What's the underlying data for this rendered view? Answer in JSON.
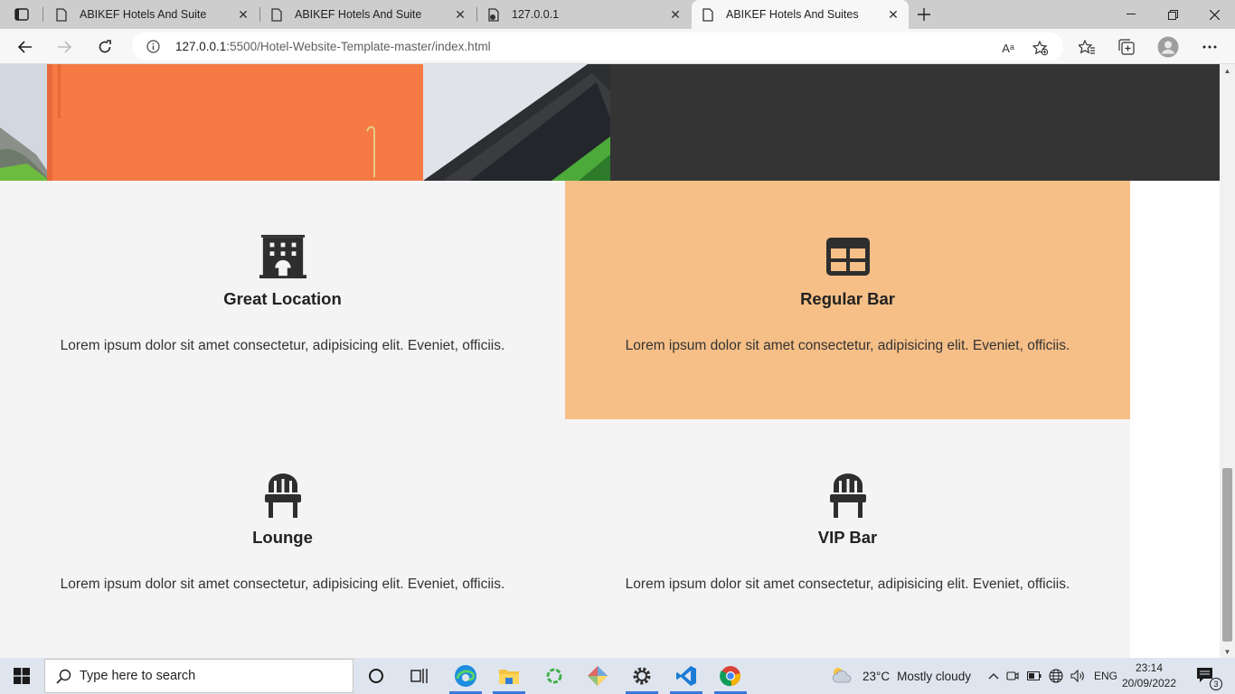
{
  "browser": {
    "tabs": [
      {
        "title": "ABIKEF Hotels And Suite",
        "active": false
      },
      {
        "title": "ABIKEF Hotels And Suite",
        "active": false
      },
      {
        "title": "127.0.0.1",
        "active": false
      },
      {
        "title": "ABIKEF Hotels And Suites",
        "active": true
      }
    ],
    "url_host": "127.0.0.1",
    "url_rest": ":5500/Hotel-Website-Template-master/index.html",
    "read_aloud_label": "Aᵃ"
  },
  "features": [
    {
      "title": "Great Location",
      "text": "Lorem ipsum dolor sit amet consectetur, adipisicing elit. Eveniet, officiis.",
      "icon": "hotel-building-icon"
    },
    {
      "title": "Regular Bar",
      "text": "Lorem ipsum dolor sit amet consectetur, adipisicing elit. Eveniet, officiis.",
      "icon": "table-icon"
    },
    {
      "title": "Lounge",
      "text": "Lorem ipsum dolor sit amet consectetur, adipisicing elit. Eveniet, officiis.",
      "icon": "chair-icon"
    },
    {
      "title": "VIP Bar",
      "text": "Lorem ipsum dolor sit amet consectetur, adipisicing elit. Eveniet, officiis.",
      "icon": "chair-icon"
    }
  ],
  "colors": {
    "accent": "#f6bf87",
    "card_bg": "#f4f4f4",
    "dark_panel": "#343434"
  },
  "taskbar": {
    "search_placeholder": "Type here to search",
    "weather_temp": "23°C",
    "weather_text": "Mostly cloudy",
    "language": "ENG",
    "time": "23:14",
    "date": "20/09/2022",
    "notifications": "3"
  }
}
